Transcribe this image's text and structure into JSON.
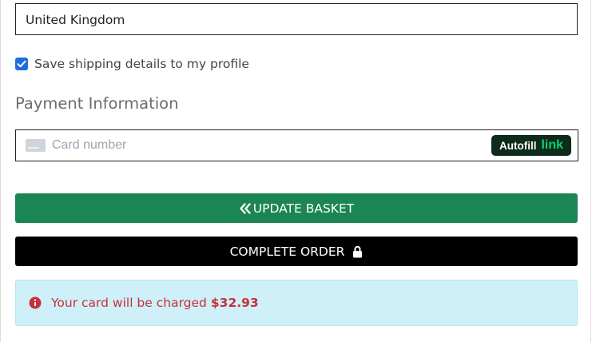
{
  "shipping": {
    "country_value": "United Kingdom",
    "save_profile_label": "Save shipping details to my profile",
    "save_profile_checked": true
  },
  "payment": {
    "section_title": "Payment Information",
    "card_placeholder": "Card number",
    "autofill_label": "Autofill",
    "autofill_brand": "link"
  },
  "actions": {
    "update_basket_label": "UPDATE BASKET",
    "complete_order_label": "COMPLETE ORDER"
  },
  "alert": {
    "message": "Your card will be charged",
    "amount": "$32.93"
  },
  "colors": {
    "update_button": "#1b8553",
    "complete_button": "#000000",
    "checkbox": "#1e6fd9",
    "alert_background": "#cff0f8",
    "alert_text": "#c6313a",
    "link_green": "#00d66f"
  }
}
